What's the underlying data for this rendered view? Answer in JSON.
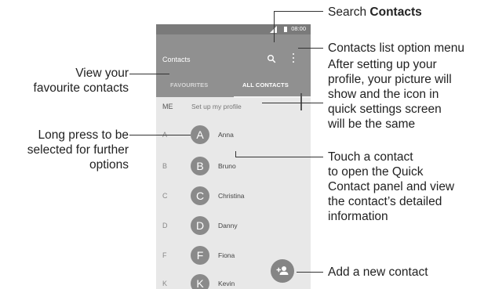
{
  "status_bar": {
    "time": "08:00"
  },
  "app_bar": {
    "title": "Contacts"
  },
  "tabs": [
    {
      "label": "FAVOURITES",
      "active": false
    },
    {
      "label": "ALL CONTACTS",
      "active": true
    }
  ],
  "me_row": {
    "label": "ME",
    "text": "Set up my profile"
  },
  "contacts": [
    {
      "letter": "A",
      "initial": "A",
      "name": "Anna"
    },
    {
      "letter": "B",
      "initial": "B",
      "name": "Bruno"
    },
    {
      "letter": "C",
      "initial": "C",
      "name": "Christina"
    },
    {
      "letter": "D",
      "initial": "D",
      "name": "Danny"
    },
    {
      "letter": "F",
      "initial": "F",
      "name": "Fiona"
    },
    {
      "letter": "K",
      "initial": "K",
      "name": "Kevin"
    }
  ],
  "annotations": {
    "search_prefix": "Search ",
    "search_bold": "Contacts",
    "options_menu": "Contacts list option menu",
    "profile_note": [
      "After setting up your",
      "profile, your picture will",
      "show and the icon in",
      "quick settings screen",
      "will be the same"
    ],
    "favourites": [
      "View your",
      "favourite contacts"
    ],
    "long_press": [
      "Long press to be",
      "selected for further",
      "options"
    ],
    "touch_contact": [
      "Touch a contact",
      "to open the Quick",
      "Contact panel and view",
      "the contact’s detailed",
      "information"
    ],
    "add_contact": "Add a new contact"
  },
  "colors": {
    "app_bar": "#909090",
    "status_bar": "#7a7a7a",
    "list_bg": "#e8e8e8",
    "avatar": "#8a8a8a"
  }
}
